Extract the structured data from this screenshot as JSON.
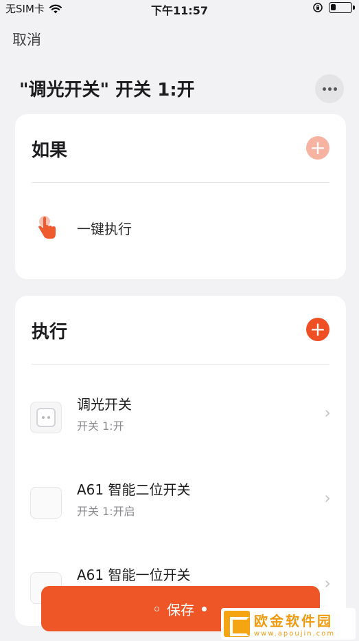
{
  "status_bar": {
    "carrier": "无SIM卡",
    "time": "下午11:57",
    "battery_level": 0.25
  },
  "nav": {
    "cancel_label": "取消",
    "title": "\"调光开关\" 开关 1:开"
  },
  "if_section": {
    "title": "如果",
    "trigger_label": "一键执行"
  },
  "do_section": {
    "title": "执行",
    "actions": [
      {
        "name": "调光开关",
        "status": "开关 1:开"
      },
      {
        "name": "A61 智能二位开关",
        "status": "开关 1:开启"
      },
      {
        "name": "A61 智能一位开关",
        "status": ""
      }
    ]
  },
  "save_label": "保存",
  "watermark": {
    "cn": "欧金软件园",
    "en": "www.apoujin.com"
  },
  "colors": {
    "accent": "#ee5627",
    "accent_light": "#f7b3a1",
    "background": "#f2f2f4"
  }
}
